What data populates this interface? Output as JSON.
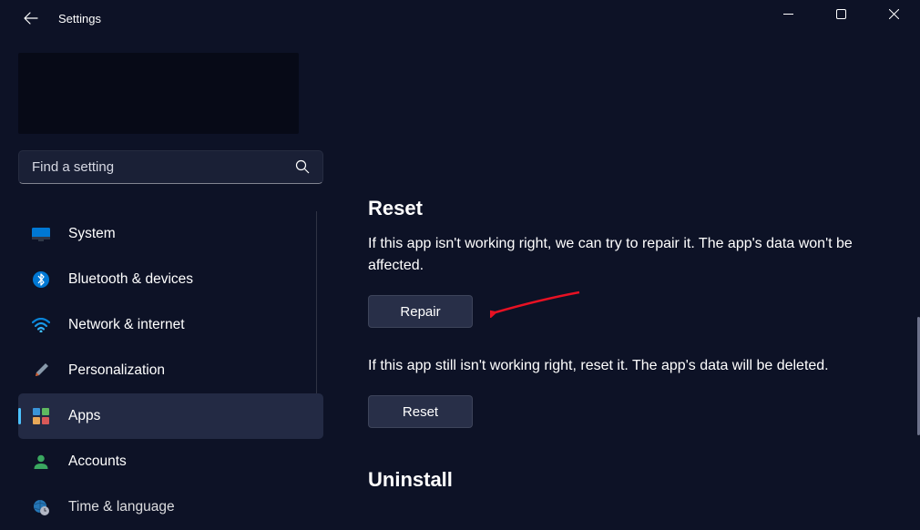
{
  "window": {
    "title": "Settings"
  },
  "search": {
    "placeholder": "Find a setting"
  },
  "nav": {
    "items": [
      {
        "id": "system",
        "label": "System"
      },
      {
        "id": "bluetooth",
        "label": "Bluetooth & devices"
      },
      {
        "id": "network",
        "label": "Network & internet"
      },
      {
        "id": "personalization",
        "label": "Personalization"
      },
      {
        "id": "apps",
        "label": "Apps",
        "selected": true
      },
      {
        "id": "accounts",
        "label": "Accounts"
      },
      {
        "id": "time",
        "label": "Time & language"
      }
    ]
  },
  "main": {
    "reset": {
      "heading": "Reset",
      "repair_desc": "If this app isn't working right, we can try to repair it. The app's data won't be affected.",
      "repair_btn": "Repair",
      "reset_desc": "If this app still isn't working right, reset it. The app's data will be deleted.",
      "reset_btn": "Reset"
    },
    "uninstall": {
      "heading": "Uninstall"
    }
  }
}
